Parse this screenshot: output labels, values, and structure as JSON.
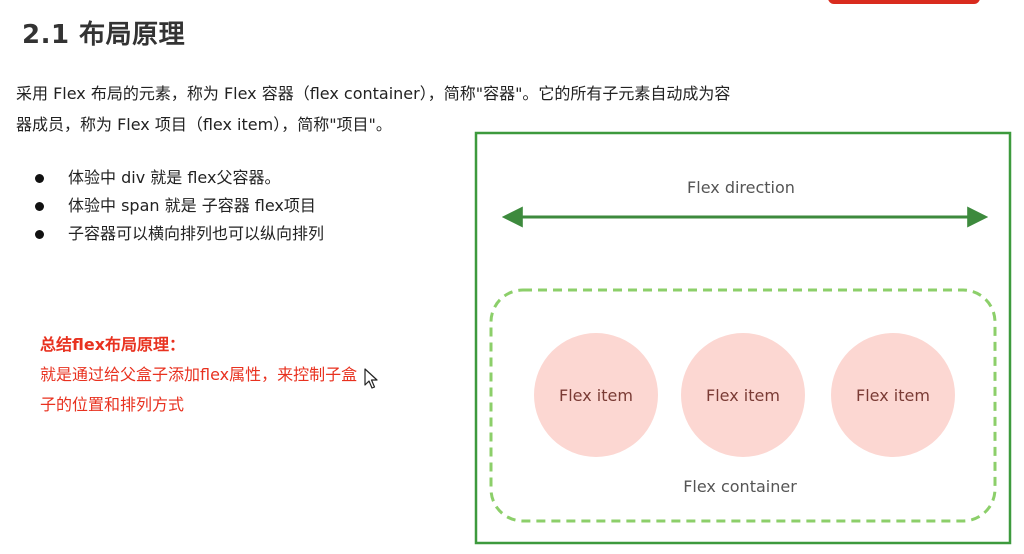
{
  "slide": {
    "title": "2.1 布局原理",
    "paragraph_line1": "采用 Flex 布局的元素，称为 Flex 容器（flex container），简称\"容器\"。它的所有子元素自动成为容",
    "paragraph_line2": "器成员，称为 Flex 项目（flex item），简称\"项目\"。",
    "bullets": [
      "体验中 div 就是 flex父容器。",
      "体验中 span 就是 子容器 flex项目",
      "子容器可以横向排列也可以纵向排列"
    ],
    "summary_title": "总结flex布局原理：",
    "summary_line1": "就是通过给父盒子添加flex属性，来控制子盒",
    "summary_line2": "子的位置和排列方式"
  },
  "diagram": {
    "direction_label": "Flex direction",
    "container_label": "Flex container",
    "items": [
      "Flex item",
      "Flex item",
      "Flex item"
    ],
    "colors": {
      "outer_border": "#3d9a3d",
      "arrow": "#3d8a3d",
      "dashed_border": "#8ccf6a",
      "item_fill": "#fcd7d2",
      "item_text": "#7a3b35",
      "label_text": "#555555"
    }
  },
  "icons": {
    "cursor": "mouse-pointer-icon",
    "top_tab": "red-tab"
  }
}
